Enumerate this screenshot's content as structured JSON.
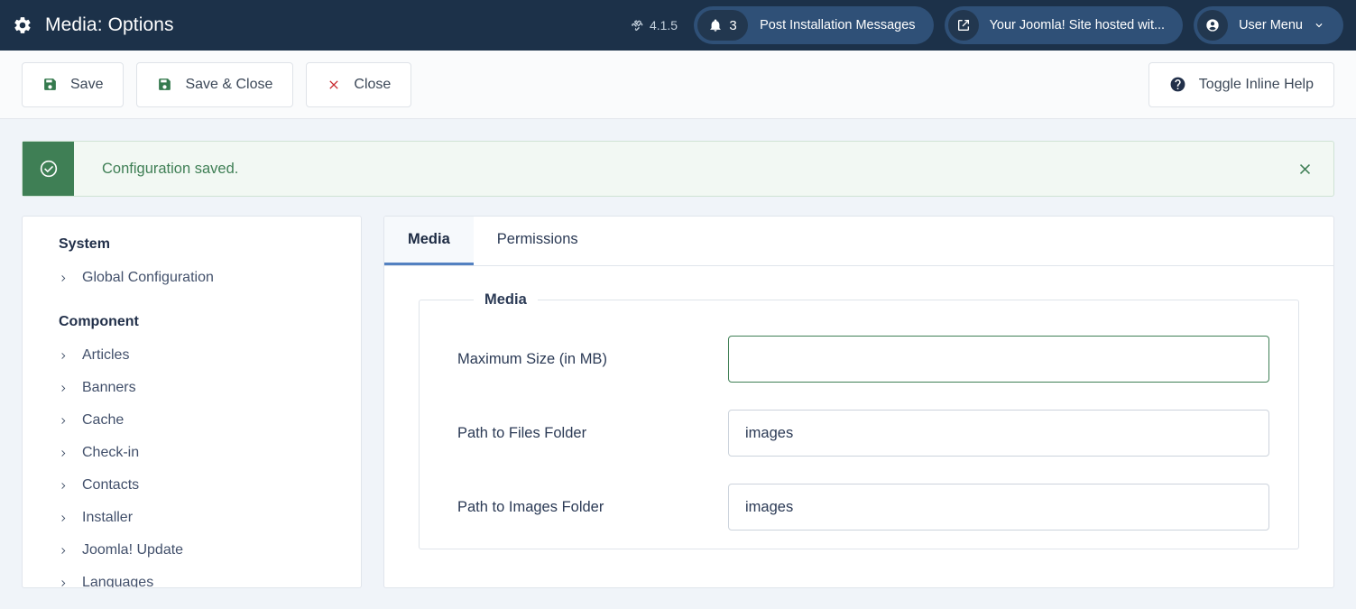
{
  "header": {
    "title": "Media: Options",
    "gear_icon": "gear-icon",
    "version": {
      "icon": "joomla-logo-icon",
      "label": "4.1.5"
    },
    "messages_pill": {
      "icon": "bell-icon",
      "count": "3",
      "label": "Post Installation Messages"
    },
    "site_pill": {
      "icon": "external-link-icon",
      "label": "Your Joomla! Site hosted wit..."
    },
    "user_menu": {
      "icon": "user-circle-icon",
      "label": "User Menu",
      "chevron": "chevron-down-icon"
    }
  },
  "toolbar": {
    "save": {
      "label": "Save",
      "icon": "floppy-disk-icon"
    },
    "save_close": {
      "label": "Save & Close",
      "icon": "floppy-disk-icon"
    },
    "close": {
      "label": "Close",
      "icon": "x-mark-icon"
    },
    "toggle_help": {
      "label": "Toggle Inline Help",
      "icon": "question-circle-icon"
    }
  },
  "alert": {
    "icon": "check-circle-icon",
    "message": "Configuration saved.",
    "close_icon": "x-mark-icon"
  },
  "sidebar": {
    "groups": [
      {
        "heading": "System",
        "items": [
          {
            "label": "Global Configuration",
            "icon": "chevron-right-icon"
          }
        ]
      },
      {
        "heading": "Component",
        "items": [
          {
            "label": "Articles",
            "icon": "chevron-right-icon"
          },
          {
            "label": "Banners",
            "icon": "chevron-right-icon"
          },
          {
            "label": "Cache",
            "icon": "chevron-right-icon"
          },
          {
            "label": "Check-in",
            "icon": "chevron-right-icon"
          },
          {
            "label": "Contacts",
            "icon": "chevron-right-icon"
          },
          {
            "label": "Installer",
            "icon": "chevron-right-icon"
          },
          {
            "label": "Joomla! Update",
            "icon": "chevron-right-icon"
          },
          {
            "label": "Languages",
            "icon": "chevron-right-icon"
          }
        ]
      }
    ]
  },
  "panel": {
    "tabs": [
      {
        "label": "Media",
        "active": true
      },
      {
        "label": "Permissions",
        "active": false
      }
    ],
    "fieldset": {
      "legend": "Media",
      "fields": [
        {
          "label": "Maximum Size (in MB)",
          "value": "",
          "placeholder": "",
          "state": "valid-green"
        },
        {
          "label": "Path to Files Folder",
          "value": "images",
          "placeholder": "",
          "state": "normal"
        },
        {
          "label": "Path to Images Folder",
          "value": "images",
          "placeholder": "",
          "state": "normal"
        }
      ]
    }
  },
  "colors": {
    "header_bg": "#1c3149",
    "pill_bg": "#2f5077",
    "accent_tab": "#5381c1",
    "success_green": "#3f7f55",
    "danger_red": "#c8262c",
    "page_bg": "#f0f4f9"
  }
}
